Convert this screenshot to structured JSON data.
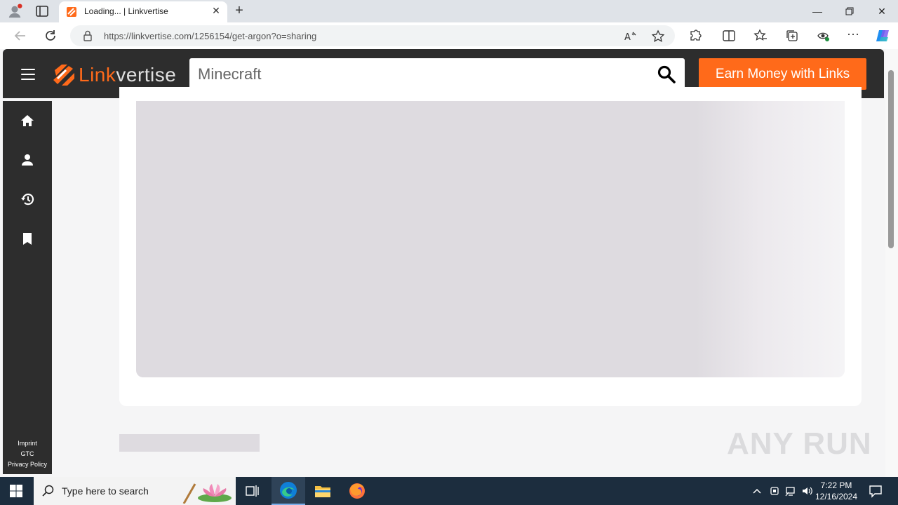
{
  "browser": {
    "tab": {
      "title": "Loading... | Linkvertise"
    },
    "url_host": "https://linkvertise.com",
    "url_path": "/1256154/get-argon?o=sharing"
  },
  "site": {
    "logo_prefix": "Link",
    "logo_suffix": "vertise",
    "search_value": "Minecraft",
    "cta_label": "Earn Money with Links",
    "footer_links": [
      "Imprint",
      "GTC",
      "Privacy Policy"
    ],
    "sidebar_icons": [
      "home-icon",
      "user-icon",
      "history-icon",
      "bookmark-icon"
    ]
  },
  "watermark": "ANY RUN",
  "taskbar": {
    "search_placeholder": "Type here to search",
    "time": "7:22 PM",
    "date": "12/16/2024"
  },
  "colors": {
    "brand_orange": "#ff6a1a",
    "header_dark": "#2d2d2d",
    "taskbar": "#1c2d3e"
  }
}
